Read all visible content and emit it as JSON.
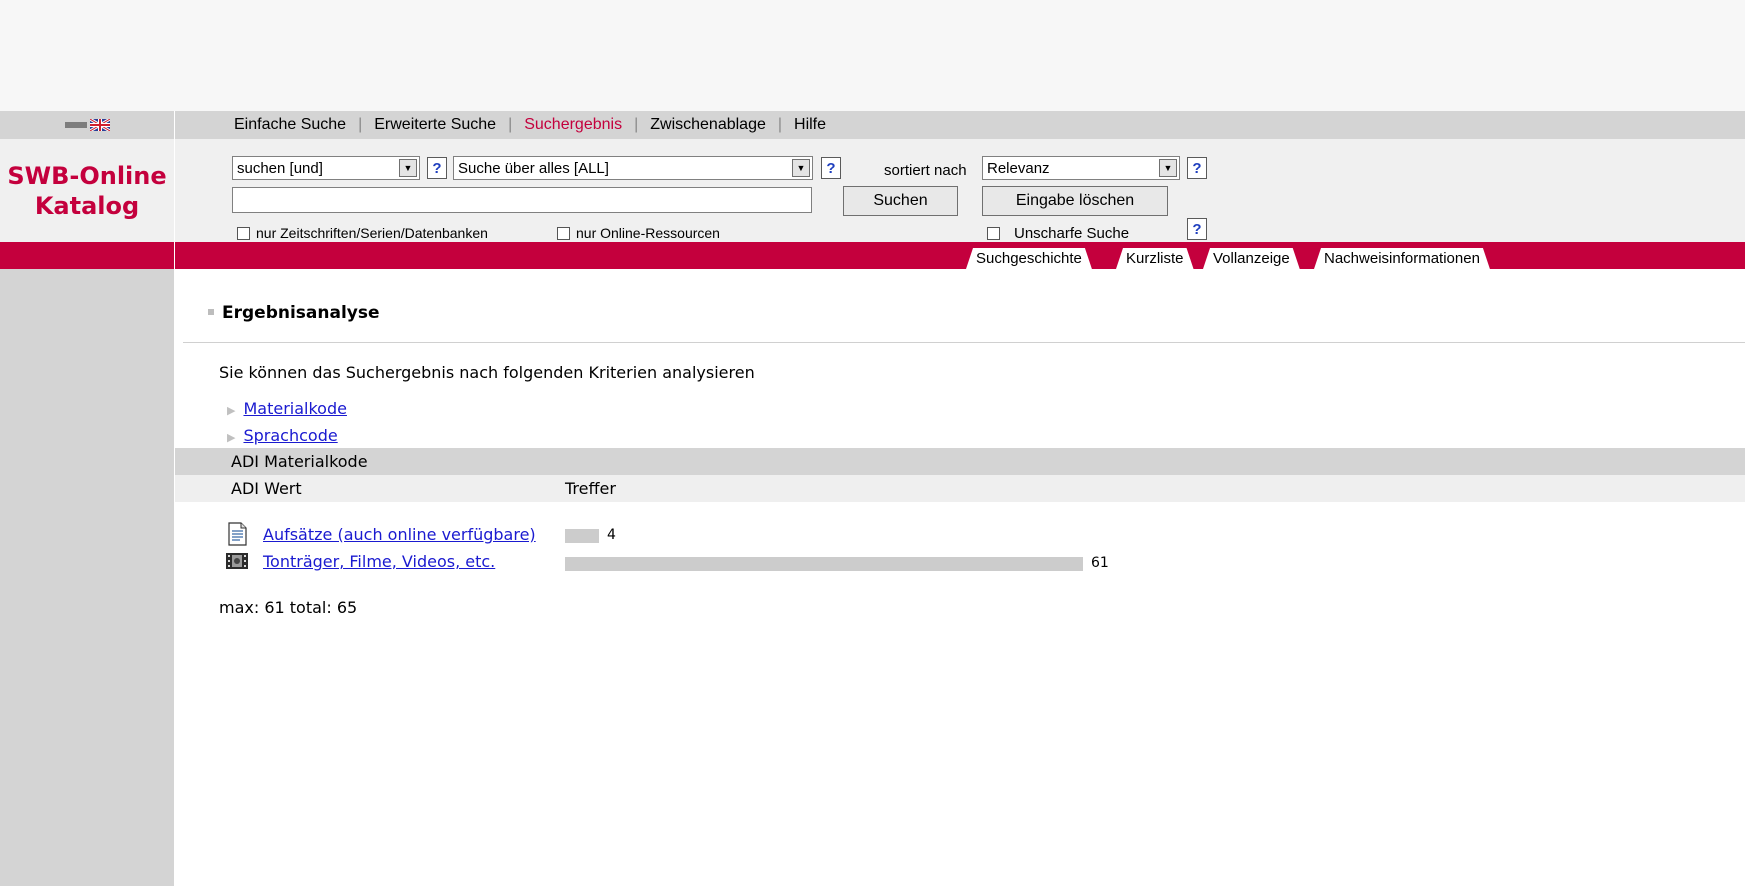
{
  "nav": {
    "items": [
      "Einfache Suche",
      "Erweiterte Suche",
      "Suchergebnis",
      "Zwischenablage",
      "Hilfe"
    ],
    "active_index": 2
  },
  "logo": {
    "line1": "SWB-Online",
    "line2": "Katalog"
  },
  "search": {
    "operator_select": "suchen [und]",
    "field_select": "Suche über alles [ALL]",
    "help_label": "?",
    "query_value": "",
    "sort_label": "sortiert nach",
    "sort_select": "Relevanz",
    "search_button": "Suchen",
    "clear_button": "Eingabe löschen",
    "checkbox_serials": "nur Zeitschriften/Serien/Datenbanken",
    "checkbox_online": "nur Online-Ressourcen",
    "fuzzy_label": "Unscharfe Suche"
  },
  "tabs": [
    "Suchgeschichte",
    "Kurzliste",
    "Vollanzeige",
    "Nachweisinformationen"
  ],
  "analysis": {
    "title": "Ergebnisanalyse",
    "description": "Sie können das Suchergebnis nach folgenden Kriterien analysieren",
    "links": [
      "Materialkode",
      "Sprachcode"
    ],
    "table_title": "ADI Materialkode",
    "col_value": "ADI Wert",
    "col_hits": "Treffer",
    "rows": [
      {
        "label": "Aufsätze (auch online verfügbare)",
        "count": 4,
        "icon": "document-icon"
      },
      {
        "label": "Tonträger, Filme, Videos, etc.",
        "count": 61,
        "icon": "film-icon"
      }
    ],
    "max_total": "max: 61 total: 65",
    "max": 61
  }
}
